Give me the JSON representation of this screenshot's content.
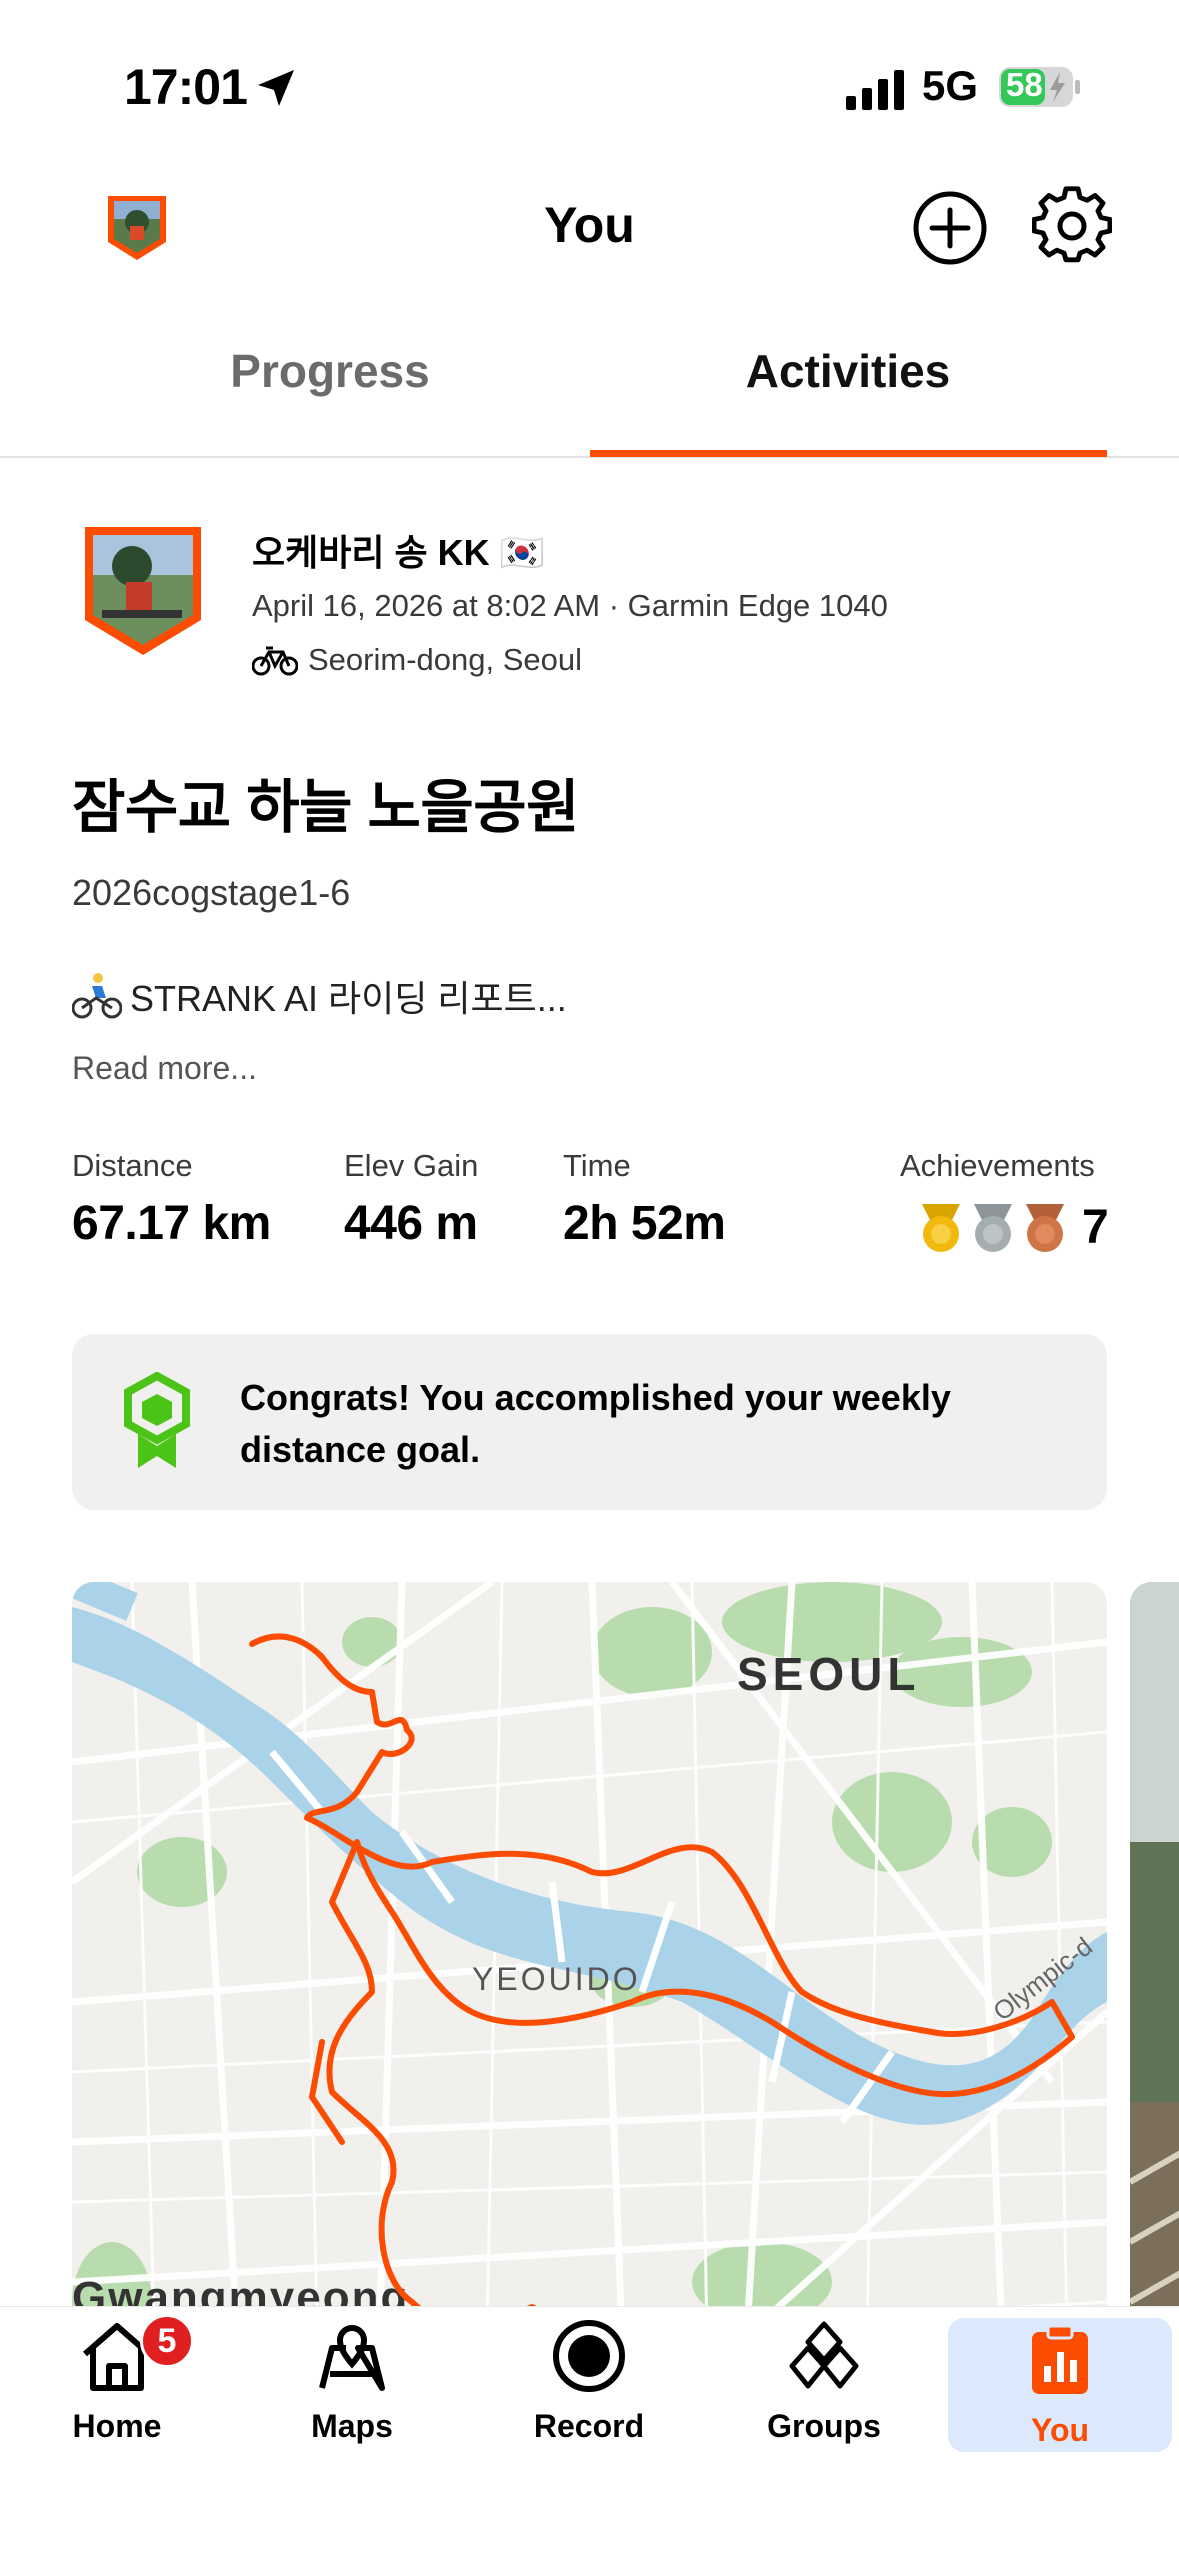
{
  "status_bar": {
    "time": "17:01",
    "network": "5G",
    "battery": "58",
    "icons": [
      "location-arrow-icon",
      "signal-icon",
      "battery-charging-icon"
    ]
  },
  "header": {
    "title": "You",
    "icons": [
      "avatar",
      "add-circle-icon",
      "gear-icon"
    ]
  },
  "tabs": [
    {
      "label": "Progress",
      "active": false
    },
    {
      "label": "Activities",
      "active": true
    }
  ],
  "activity": {
    "athlete": "오케바리 송 KK 🇰🇷",
    "meta": "April 16, 2026 at 8:02 AM · Garmin Edge 1040",
    "location": "Seorim-dong, Seoul",
    "title": "잠수교 하늘 노을공원",
    "subtitle": "2026cogstage1-6",
    "description": "STRANK AI 라이딩 리포트...",
    "read_more": "Read more...",
    "stats": [
      {
        "label": "Distance",
        "value": "67.17 km"
      },
      {
        "label": "Elev Gain",
        "value": "446 m"
      },
      {
        "label": "Time",
        "value": "2h 52m"
      },
      {
        "label": "Achievements",
        "value": "7"
      }
    ],
    "goal_message": "Congrats! You accomplished your weekly distance goal.",
    "map_labels": {
      "city": "SEOUL",
      "district": "YEOUIDO",
      "road": "Olympic-d",
      "area": "Gwangmyeong"
    }
  },
  "tabbar": [
    {
      "label": "Home",
      "icon": "home-icon",
      "badge": "5"
    },
    {
      "label": "Maps",
      "icon": "maps-icon"
    },
    {
      "label": "Record",
      "icon": "record-icon"
    },
    {
      "label": "Groups",
      "icon": "groups-icon"
    },
    {
      "label": "You",
      "icon": "you-icon",
      "active": true
    }
  ],
  "colors": {
    "accent": "#fc4c02",
    "active_tab_bg": "#dce8fb",
    "badge": "#e02020",
    "goal_green": "#4cc417"
  }
}
